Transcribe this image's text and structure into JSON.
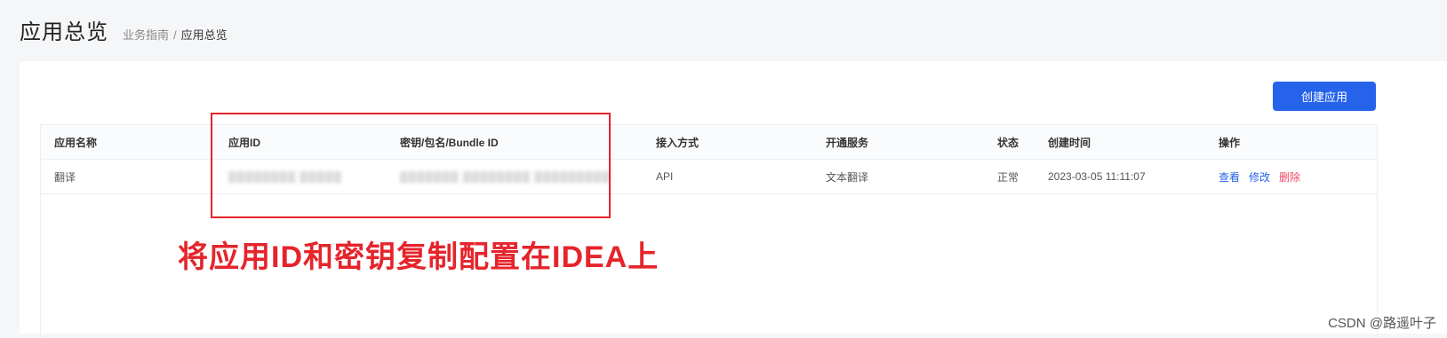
{
  "header": {
    "title": "应用总览",
    "breadcrumb": [
      "业务指南",
      "应用总览"
    ],
    "breadcrumb_sep": "/"
  },
  "toolbar": {
    "create_label": "创建应用"
  },
  "table": {
    "columns": [
      "应用名称",
      "应用ID",
      "密钥/包名/Bundle ID",
      "接入方式",
      "开通服务",
      "状态",
      "创建时间",
      "操作"
    ],
    "rows": [
      {
        "name": "翻译",
        "app_id": "",
        "secret": "",
        "access": "API",
        "service": "文本翻译",
        "status": "正常",
        "created": "2023-03-05 11:11:07",
        "actions": [
          "查看",
          "修改",
          "删除"
        ]
      }
    ]
  },
  "annotation": {
    "text": "将应用ID和密钥复制配置在IDEA上",
    "color": "#e5242b"
  },
  "watermark": "CSDN @路遥叶子",
  "colors": {
    "primary": "#2563eb",
    "danger": "#f04863",
    "annotation": "#e5242b",
    "background": "#f5f6f8"
  }
}
